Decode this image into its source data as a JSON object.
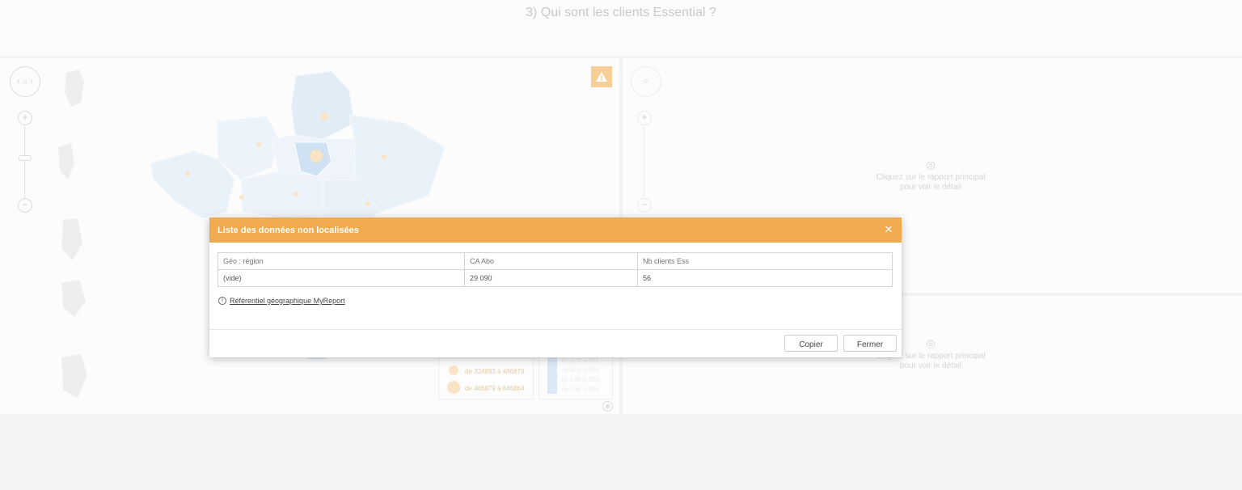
{
  "page": {
    "title": "3) Qui sont les clients Essential ?"
  },
  "map_panel": {
    "legend_circles": [
      "de 324893 à 486879",
      "de 486879 à 648864"
    ],
    "legend_blue": [
      "de 204 à 401",
      "de 401 à 599",
      "de 599 à 796",
      "de 796 à 994"
    ]
  },
  "right_panels": {
    "top_placeholder": [
      "Cliquez sur le rapport principal",
      "pour voir le détail"
    ],
    "bottom_placeholder": [
      "Cliquez sur le rapport principal",
      "pour voir le détail"
    ]
  },
  "modal": {
    "title": "Liste des données non localisées",
    "columns": [
      "Géo : région",
      "CA Abo",
      "Nb clients Ess"
    ],
    "rows": [
      [
        "(vide)",
        "29 090",
        "56"
      ]
    ],
    "link_label": "Référentiel géographique MyReport",
    "copy_label": "Copier",
    "close_label": "Fermer"
  },
  "colors": {
    "accent": "#f0ab4f",
    "map_fill": "#e8f0f8"
  }
}
